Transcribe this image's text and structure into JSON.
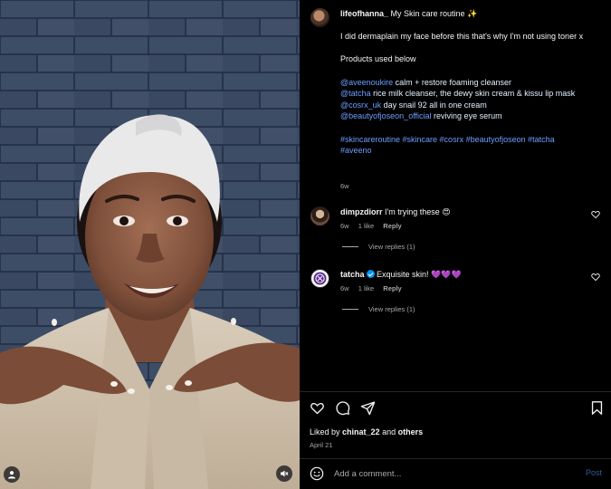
{
  "post": {
    "username": "lifeofhanna_",
    "title_text": "My Skin care routine ✨",
    "caption_line1": "I did dermaplain my face before this that's why I'm not using toner x",
    "caption_line2": "Products used below",
    "products": [
      {
        "handle": "@aveenoukire",
        "text": " calm + restore foaming cleanser"
      },
      {
        "handle": "@tatcha",
        "text": " rice milk cleanser, the dewy skin cream & kissu lip mask"
      },
      {
        "handle": "@cosrx_uk",
        "text": " day snail 92 all in one cream"
      },
      {
        "handle": "@beautyofjoseon_official",
        "text": " reviving eye serum"
      }
    ],
    "hashtags_line1": "#skincareroutine #skincare #cosrx #beautyofjoseon #tatcha",
    "hashtags_line2": "#aveeno",
    "time_ago": "6w"
  },
  "comments": [
    {
      "username": "dimpzdiorr",
      "text": "I'm trying these 😍",
      "time": "6w",
      "likes": "1 like",
      "reply": "Reply",
      "view_replies": "View replies (1)"
    },
    {
      "username": "tatcha",
      "text": "Exquisite skin! 💜💜💜",
      "time": "6w",
      "likes": "1 like",
      "reply": "Reply",
      "view_replies": "View replies (1)"
    }
  ],
  "likes": {
    "prefix": "Liked by ",
    "user": "chinat_22",
    "and": " and ",
    "others": "others"
  },
  "date": "April 21",
  "add_comment": {
    "placeholder": "Add a comment...",
    "post_label": "Post"
  },
  "icons": {
    "like": "heart-icon",
    "comment": "comment-bubble-icon",
    "share": "paper-plane-icon",
    "save": "bookmark-icon",
    "user_tag": "user-icon",
    "mute": "speaker-muted-icon",
    "emoji": "smiley-icon"
  },
  "colors": {
    "background": "#000000",
    "link": "#6d9eff",
    "muted_text": "#a8a8a8",
    "verified": "#0095f6",
    "post_button_disabled": "#2f5e9b"
  }
}
